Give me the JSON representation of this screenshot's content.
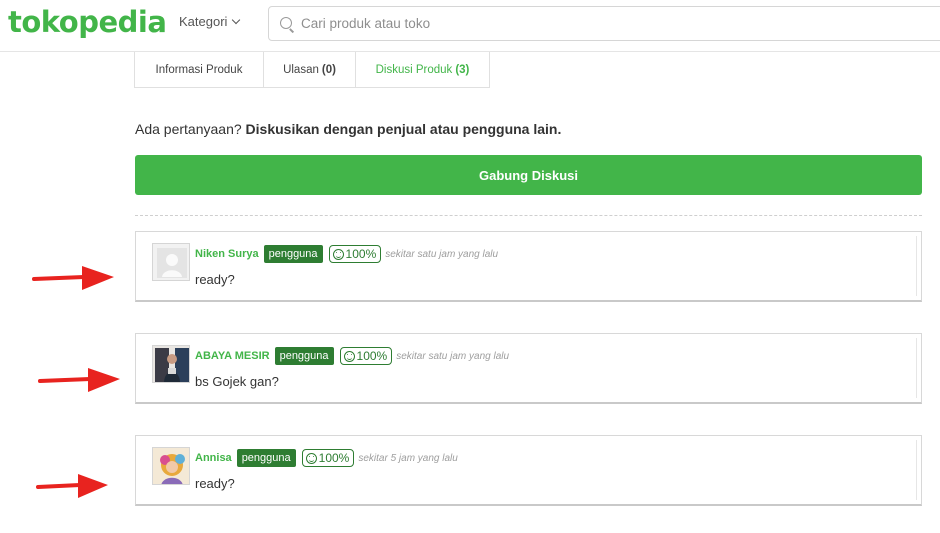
{
  "header": {
    "logo": "tokopedia",
    "kategori": "Kategori",
    "search_placeholder": "Cari produk atau toko"
  },
  "tabs": [
    {
      "label": "Informasi Produk",
      "count": ""
    },
    {
      "label": "Ulasan",
      "count": "(0)"
    },
    {
      "label": "Diskusi Produk",
      "count": "(3)"
    }
  ],
  "intro": {
    "question": "Ada pertanyaan?",
    "prompt": "Diskusikan dengan penjual atau pengguna lain."
  },
  "join_button": "Gabung Diskusi",
  "comments": [
    {
      "name": "Niken Surya",
      "role": "pengguna",
      "reputation": "100%",
      "time": "sekitar satu jam yang lalu",
      "message": "ready?"
    },
    {
      "name": "ABAYA MESIR",
      "role": "pengguna",
      "reputation": "100%",
      "time": "sekitar satu jam yang lalu",
      "message": "bs Gojek gan?"
    },
    {
      "name": "Annisa",
      "role": "pengguna",
      "reputation": "100%",
      "time": "sekitar 5 jam yang lalu",
      "message": "ready?"
    }
  ],
  "colors": {
    "brand": "#42b549",
    "badge": "#2e7d32",
    "annotation_arrow": "#e8231f"
  }
}
